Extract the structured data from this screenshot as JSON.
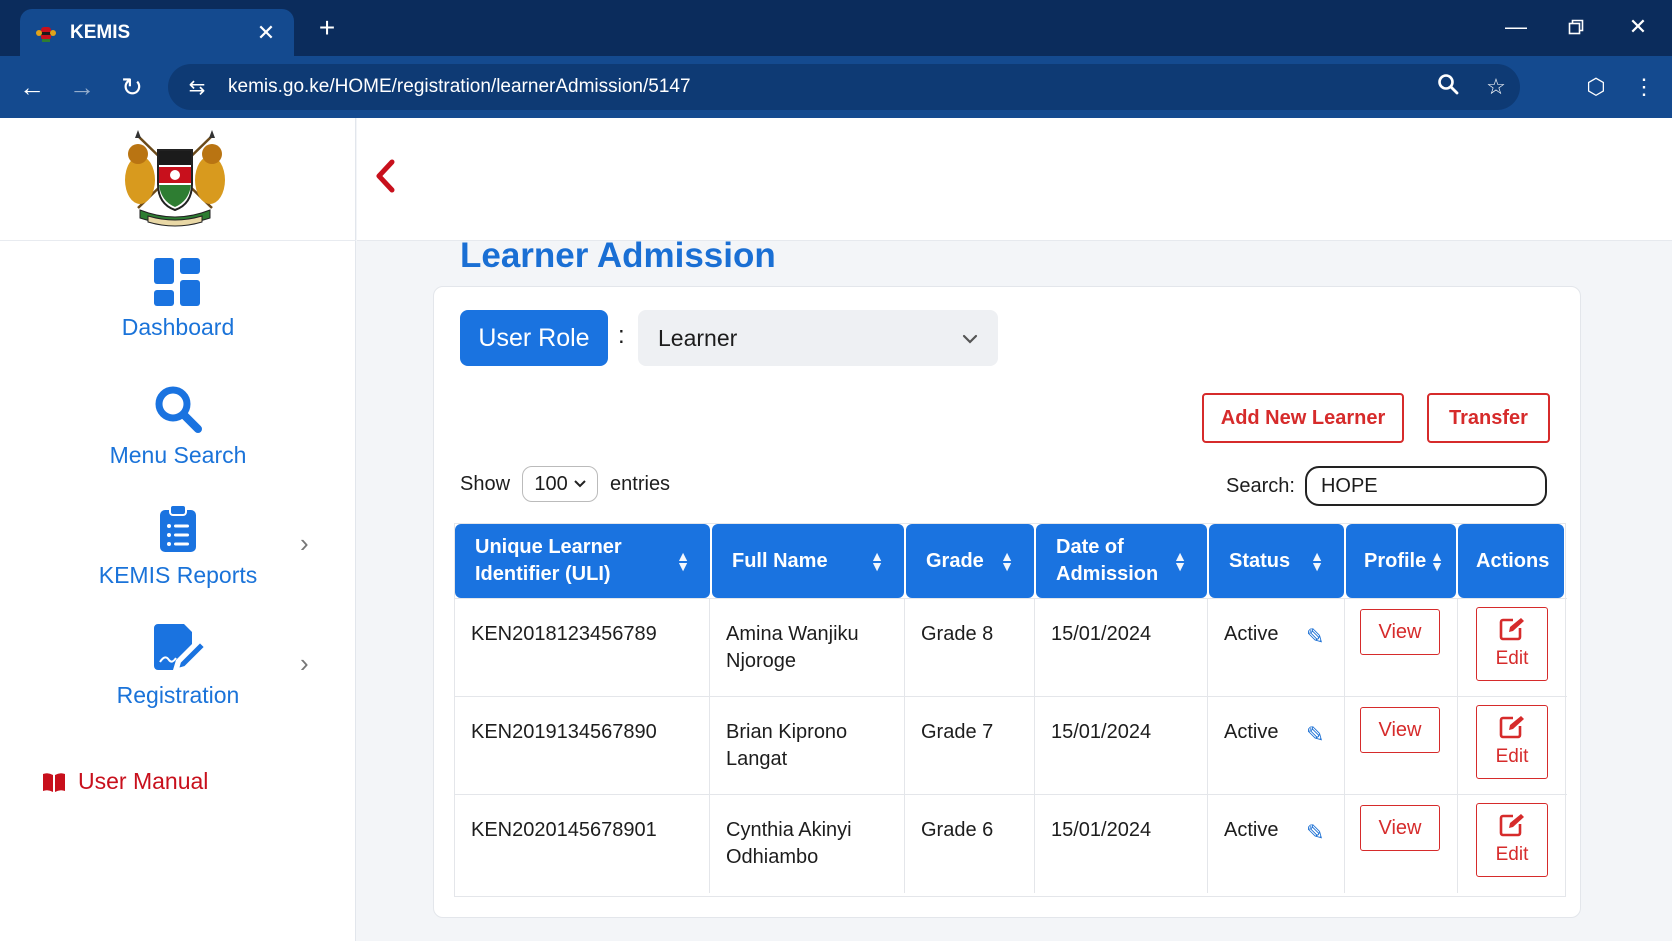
{
  "browser": {
    "tab_title": "KEMIS",
    "url": "kemis.go.ke/HOME/registration/learnerAdmission/5147"
  },
  "sidebar": {
    "items": [
      {
        "label": "Dashboard",
        "icon": "dashboard-grid-icon"
      },
      {
        "label": "Menu Search",
        "icon": "search-icon"
      },
      {
        "label": "KEMIS Reports",
        "icon": "clipboard-list-icon"
      },
      {
        "label": "Registration",
        "icon": "edit-document-icon"
      }
    ],
    "manual_label": "User Manual"
  },
  "page": {
    "title": "Learner Admission",
    "role_button": "User Role",
    "role_colon": ":",
    "role_value": "Learner",
    "add_button": "Add New Learner",
    "transfer_button": "Transfer",
    "show_label": "Show",
    "entries_value": "100",
    "entries_label": "entries",
    "search_label": "Search:",
    "search_value": "HOPE"
  },
  "table": {
    "headers": [
      "Unique Learner Identifier (ULI)",
      "Full Name",
      "Grade",
      "Date of Admission",
      "Status",
      "Profile",
      "Actions"
    ],
    "rows": [
      {
        "uli": "KEN2018123456789",
        "name": "Amina Wanjiku Njoroge",
        "grade": "Grade 8",
        "date": "15/01/2024",
        "status": "Active",
        "view": "View",
        "edit": "Edit"
      },
      {
        "uli": "KEN2019134567890",
        "name": "Brian Kiprono Langat",
        "grade": "Grade 7",
        "date": "15/01/2024",
        "status": "Active",
        "view": "View",
        "edit": "Edit"
      },
      {
        "uli": "KEN2020145678901",
        "name": "Cynthia Akinyi Odhiambo",
        "grade": "Grade 6",
        "date": "15/01/2024",
        "status": "Active",
        "view": "View",
        "edit": "Edit"
      }
    ]
  },
  "colors": {
    "primary": "#1a73e0",
    "danger": "#d62b2b",
    "chrome": "#144a8f"
  }
}
